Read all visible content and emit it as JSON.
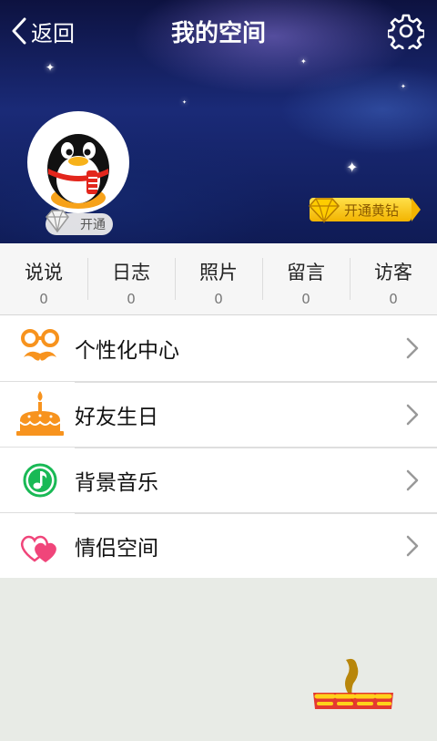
{
  "header": {
    "back_label": "返回",
    "title": "我的空间"
  },
  "profile": {
    "open_badge_label": "开通",
    "yellow_diamond_label": "开通黄钻"
  },
  "stats": [
    {
      "label": "说说",
      "count": "0"
    },
    {
      "label": "日志",
      "count": "0"
    },
    {
      "label": "照片",
      "count": "0"
    },
    {
      "label": "留言",
      "count": "0"
    },
    {
      "label": "访客",
      "count": "0"
    }
  ],
  "menu": [
    {
      "label": "个性化中心",
      "icon": "mustache-icon"
    },
    {
      "label": "好友生日",
      "icon": "birthday-cake-icon"
    },
    {
      "label": "背景音乐",
      "icon": "music-note-icon"
    },
    {
      "label": "情侣空间",
      "icon": "hearts-icon"
    }
  ],
  "colors": {
    "accent_orange": "#f7931e",
    "music_green": "#19b955",
    "heart_pink": "#f0457a",
    "diamond_yellow": "#ffd21a"
  }
}
